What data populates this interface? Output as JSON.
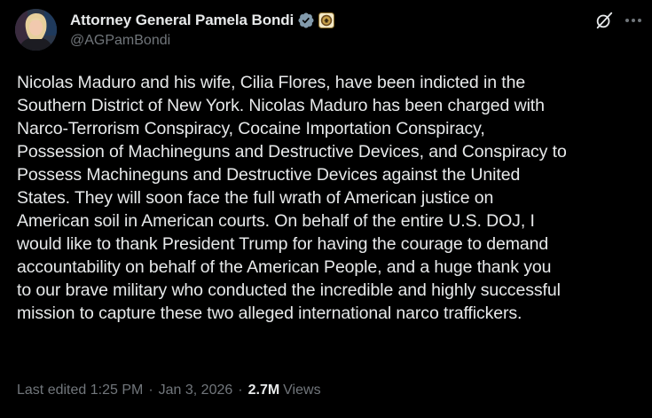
{
  "author": {
    "display_name": "Attorney General Pamela Bondi",
    "handle": "@AGPamBondi",
    "avatar": "avatar-photo",
    "verified_badge": "verified-badge-icon",
    "affiliate_badge": "doj-seal-icon"
  },
  "actions": {
    "grok_icon": "grok-icon",
    "more_icon": "more-icon"
  },
  "post": {
    "lines": [
      "Nicolas Maduro and his wife, Cilia Flores, have been indicted in the",
      "Southern District of New York.  Nicolas Maduro has been charged with",
      "Narco-Terrorism Conspiracy, Cocaine Importation Conspiracy,",
      "Possession of Machineguns and Destructive Devices, and Conspiracy to",
      "Possess Machineguns and Destructive Devices against the United",
      "States.  They will soon face the full wrath of American justice on",
      "American soil in American courts. On behalf of the entire U.S. DOJ, I",
      "would like to thank President Trump for having the courage to demand",
      "accountability on behalf of the American People, and a huge thank you",
      "to our brave military who conducted the incredible and highly successful",
      "mission to capture these two alleged international narco traffickers."
    ]
  },
  "meta": {
    "edited_prefix": "Last edited 1:25 PM",
    "separator": "·",
    "date": "Jan 3, 2026",
    "views_count": "2.7M",
    "views_label": "Views"
  },
  "colors": {
    "background": "#000000",
    "primary_text": "#e7e9ea",
    "secondary_text": "#71767b",
    "verified_badge": "#829aab"
  }
}
